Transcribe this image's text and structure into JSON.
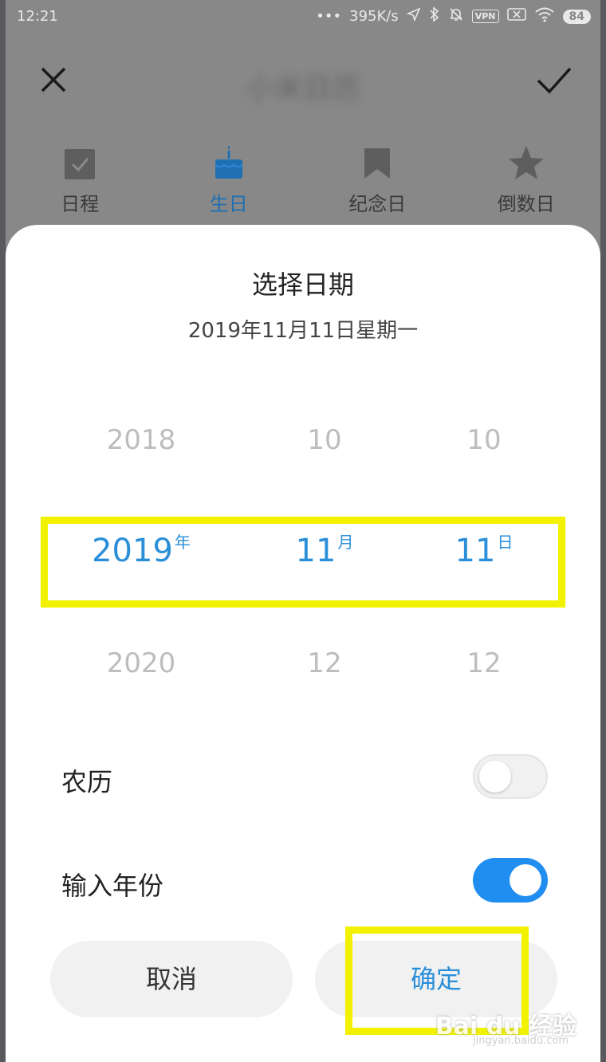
{
  "status_bar": {
    "time": "12:21",
    "net_speed": "395K/s",
    "vpn": "VPN",
    "battery": "84"
  },
  "header": {
    "title": "小米日历"
  },
  "tabs": [
    {
      "label": "日程",
      "icon": "checkbox-icon",
      "active": false
    },
    {
      "label": "生日",
      "icon": "cake-icon",
      "active": true
    },
    {
      "label": "纪念日",
      "icon": "bookmark-icon",
      "active": false
    },
    {
      "label": "倒数日",
      "icon": "star-icon",
      "active": false
    }
  ],
  "dialog": {
    "title": "选择日期",
    "subtitle": "2019年11月11日星期一",
    "picker": {
      "prev": {
        "year": "2018",
        "month": "10",
        "day": "10"
      },
      "selected": {
        "year": "2019",
        "year_unit": "年",
        "month": "11",
        "month_unit": "月",
        "day": "11",
        "day_unit": "日"
      },
      "next": {
        "year": "2020",
        "month": "12",
        "day": "12"
      }
    },
    "lunar": {
      "label": "农历",
      "enabled": false
    },
    "input_year": {
      "label": "输入年份",
      "enabled": true
    },
    "cancel_label": "取消",
    "ok_label": "确定"
  },
  "watermark": {
    "brand": "Bai du 经验",
    "url": "jingyan.baidu.com"
  },
  "colors": {
    "accent": "#2a8fd8",
    "highlight": "#f2f200",
    "toggle_on": "#1f8ef0"
  }
}
